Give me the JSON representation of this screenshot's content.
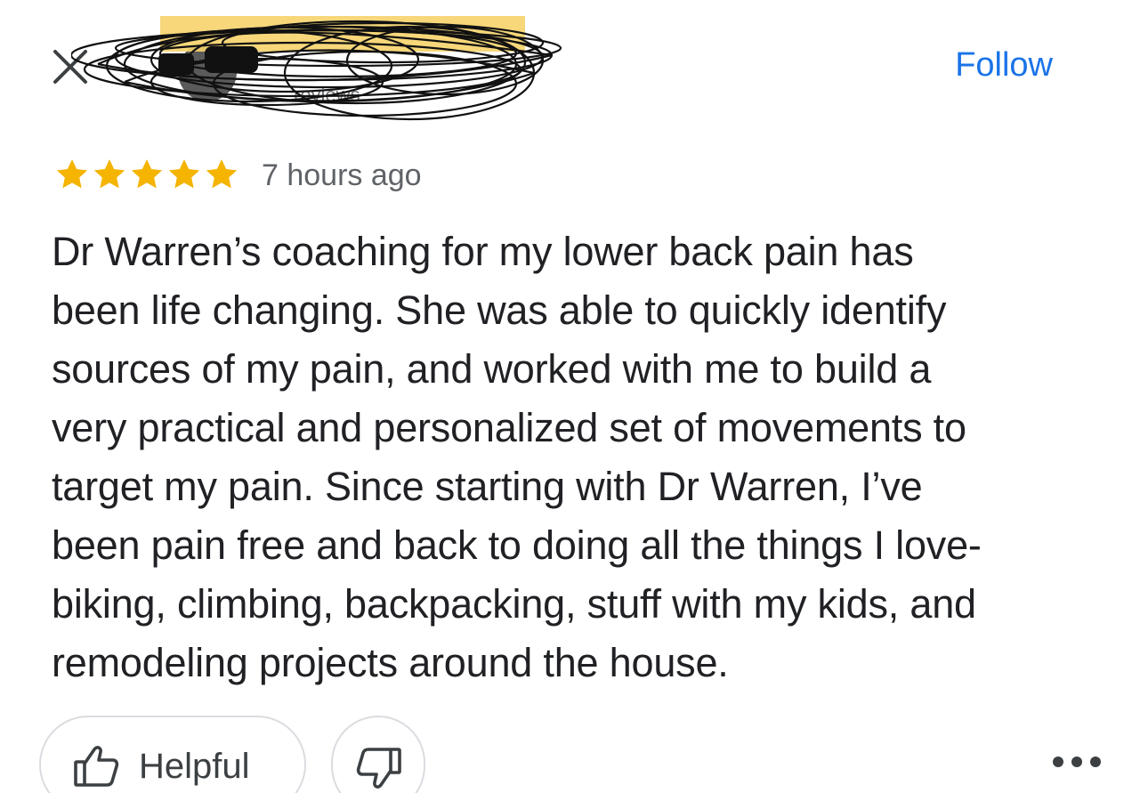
{
  "header": {
    "reviewer_name": "",
    "reviewer_meta": "reviews",
    "follow_label": "Follow"
  },
  "review": {
    "rating": 5,
    "rating_max": 5,
    "time_ago": "7 hours ago",
    "text": "Dr Warren’s coaching for my lower back pain has\nbeen life changing. She was able to quickly identify\nsources of my pain, and worked with me to build a\nvery practical and personalized set of movements to\ntarget my pain. Since starting with Dr Warren, I’ve\nbeen pain free and back to doing all the things I love-\nbiking, climbing, backpacking, stuff with my kids, and\nremodeling projects around the house."
  },
  "actions": {
    "helpful_label": "Helpful"
  },
  "icons": {
    "close": "close-icon",
    "star": "star-icon",
    "thumbs_up": "thumbs-up-icon",
    "thumbs_down": "thumbs-down-icon",
    "more": "more-horiz-icon"
  },
  "colors": {
    "accent": "#1a73e8",
    "star": "#f4b400",
    "text": "#202124",
    "secondary_text": "#5f6368",
    "border": "#dadce0",
    "redaction_highlight": "#f6d36b"
  }
}
